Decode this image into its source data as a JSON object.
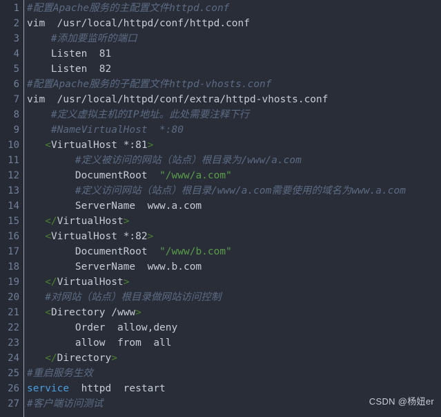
{
  "editor": {
    "theme": "dark",
    "background_color": "#282d38",
    "gutter_color": "#252a34",
    "line_count": 27,
    "colors": {
      "comment": "#5d6b82",
      "string": "#5a9c4a",
      "tag": "#4d8030",
      "keyword": "#4a9ee0",
      "plain": "#c7ccd6",
      "lineno": "#72809a"
    }
  },
  "watermark": {
    "text": "CSDN @杨妞er"
  },
  "lines": [
    {
      "n": "1",
      "tokens": [
        {
          "t": "comment",
          "v": "#配置Apache服务的主配置文件httpd.conf"
        }
      ]
    },
    {
      "n": "2",
      "tokens": [
        {
          "t": "plain",
          "v": "vim  /usr/local/httpd/conf/httpd.conf"
        }
      ]
    },
    {
      "n": "3",
      "tokens": [
        {
          "t": "comment",
          "v": "    #添加要监听的端口"
        }
      ]
    },
    {
      "n": "4",
      "tokens": [
        {
          "t": "plain",
          "v": "    Listen  81"
        }
      ]
    },
    {
      "n": "5",
      "tokens": [
        {
          "t": "plain",
          "v": "    Listen  82"
        }
      ]
    },
    {
      "n": "6",
      "tokens": [
        {
          "t": "comment",
          "v": "#配置Apache服务的子配置文件httpd-vhosts.conf"
        }
      ]
    },
    {
      "n": "7",
      "tokens": [
        {
          "t": "plain",
          "v": "vim  /usr/local/httpd/conf/extra/httpd-vhosts.conf"
        }
      ]
    },
    {
      "n": "8",
      "tokens": [
        {
          "t": "comment",
          "v": "    #定义虚拟主机的IP地址。此处需要注释下行"
        }
      ]
    },
    {
      "n": "9",
      "tokens": [
        {
          "t": "comment",
          "v": "    #NameVirtualHost  *:80"
        }
      ]
    },
    {
      "n": "10",
      "tokens": [
        {
          "t": "plain",
          "v": "   "
        },
        {
          "t": "tag",
          "v": "<"
        },
        {
          "t": "tagname",
          "v": "VirtualHost *:81"
        },
        {
          "t": "tag",
          "v": ">"
        }
      ]
    },
    {
      "n": "11",
      "tokens": [
        {
          "t": "comment",
          "v": "        #定义被访问的网站（站点）根目录为/www/a.com"
        }
      ]
    },
    {
      "n": "12",
      "tokens": [
        {
          "t": "plain",
          "v": "        DocumentRoot  "
        },
        {
          "t": "string",
          "v": "\"/www/a.com\""
        }
      ]
    },
    {
      "n": "13",
      "tokens": [
        {
          "t": "comment",
          "v": "        #定义访问网站（站点）根目录/www/a.com需要使用的域名为www.a.com"
        }
      ]
    },
    {
      "n": "14",
      "tokens": [
        {
          "t": "plain",
          "v": "        ServerName  www.a.com"
        }
      ]
    },
    {
      "n": "15",
      "tokens": [
        {
          "t": "plain",
          "v": "   "
        },
        {
          "t": "tag",
          "v": "</"
        },
        {
          "t": "tagname",
          "v": "VirtualHost"
        },
        {
          "t": "tag",
          "v": ">"
        }
      ]
    },
    {
      "n": "16",
      "tokens": [
        {
          "t": "plain",
          "v": "   "
        },
        {
          "t": "tag",
          "v": "<"
        },
        {
          "t": "tagname",
          "v": "VirtualHost *:82"
        },
        {
          "t": "tag",
          "v": ">"
        }
      ]
    },
    {
      "n": "17",
      "tokens": [
        {
          "t": "plain",
          "v": "        DocumentRoot  "
        },
        {
          "t": "string",
          "v": "\"/www/b.com\""
        }
      ]
    },
    {
      "n": "18",
      "tokens": [
        {
          "t": "plain",
          "v": "        ServerName  www.b.com"
        }
      ]
    },
    {
      "n": "19",
      "tokens": [
        {
          "t": "plain",
          "v": "   "
        },
        {
          "t": "tag",
          "v": "</"
        },
        {
          "t": "tagname",
          "v": "VirtualHost"
        },
        {
          "t": "tag",
          "v": ">"
        }
      ]
    },
    {
      "n": "20",
      "tokens": [
        {
          "t": "comment",
          "v": "   #对网站（站点）根目录做网站访问控制"
        }
      ]
    },
    {
      "n": "21",
      "tokens": [
        {
          "t": "plain",
          "v": "   "
        },
        {
          "t": "tag",
          "v": "<"
        },
        {
          "t": "tagname",
          "v": "Directory /www"
        },
        {
          "t": "tag",
          "v": ">"
        }
      ]
    },
    {
      "n": "22",
      "tokens": [
        {
          "t": "plain",
          "v": "        Order  allow,deny"
        }
      ]
    },
    {
      "n": "23",
      "tokens": [
        {
          "t": "plain",
          "v": "        allow  from  all"
        }
      ]
    },
    {
      "n": "24",
      "tokens": [
        {
          "t": "plain",
          "v": "   "
        },
        {
          "t": "tag",
          "v": "</"
        },
        {
          "t": "tagname",
          "v": "Directory"
        },
        {
          "t": "tag",
          "v": ">"
        }
      ]
    },
    {
      "n": "25",
      "tokens": [
        {
          "t": "comment",
          "v": "#重启服务生效"
        }
      ]
    },
    {
      "n": "26",
      "tokens": [
        {
          "t": "keyword",
          "v": "service"
        },
        {
          "t": "plain",
          "v": "  httpd  restart"
        }
      ]
    },
    {
      "n": "27",
      "tokens": [
        {
          "t": "comment",
          "v": "#客户端访问测试"
        }
      ]
    }
  ]
}
